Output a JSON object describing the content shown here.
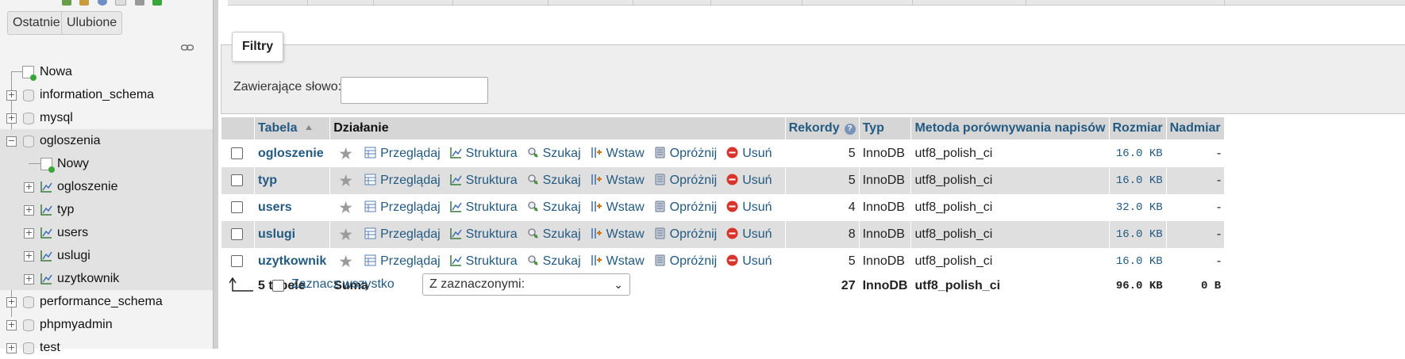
{
  "sidebar": {
    "tabs": [
      "Ostatnie",
      "Ulubione"
    ],
    "tree": [
      {
        "label": "Nowa",
        "level": 0,
        "kind": "new"
      },
      {
        "label": "information_schema",
        "level": 0,
        "kind": "db"
      },
      {
        "label": "mysql",
        "level": 0,
        "kind": "db"
      },
      {
        "label": "ogloszenia",
        "level": 0,
        "kind": "db",
        "expanded": true,
        "selected": true
      },
      {
        "label": "Nowy",
        "level": 1,
        "kind": "new",
        "selected": true
      },
      {
        "label": "ogloszenie",
        "level": 1,
        "kind": "table",
        "selected": true
      },
      {
        "label": "typ",
        "level": 1,
        "kind": "table",
        "selected": true
      },
      {
        "label": "users",
        "level": 1,
        "kind": "table",
        "selected": true
      },
      {
        "label": "uslugi",
        "level": 1,
        "kind": "table",
        "selected": true
      },
      {
        "label": "uzytkownik",
        "level": 1,
        "kind": "table",
        "selected": true
      },
      {
        "label": "performance_schema",
        "level": 0,
        "kind": "db"
      },
      {
        "label": "phpmyadmin",
        "level": 0,
        "kind": "db"
      },
      {
        "label": "test",
        "level": 0,
        "kind": "db"
      }
    ]
  },
  "filters": {
    "legend": "Filtry",
    "label": "Zawierające słowo:",
    "value": ""
  },
  "table": {
    "headers": {
      "table": "Tabela",
      "action": "Działanie",
      "records": "Rekordy",
      "type": "Typ",
      "collation": "Metoda porównywania napisów",
      "size": "Rozmiar",
      "overhead": "Nadmiar"
    },
    "actions": [
      "Przeglądaj",
      "Struktura",
      "Szukaj",
      "Wstaw",
      "Opróżnij",
      "Usuń"
    ],
    "rows": [
      {
        "name": "ogloszenie",
        "records": "5",
        "type": "InnoDB",
        "collation": "utf8_polish_ci",
        "size": "16.0 KB",
        "overhead": "-"
      },
      {
        "name": "typ",
        "records": "5",
        "type": "InnoDB",
        "collation": "utf8_polish_ci",
        "size": "16.0 KB",
        "overhead": "-"
      },
      {
        "name": "users",
        "records": "4",
        "type": "InnoDB",
        "collation": "utf8_polish_ci",
        "size": "32.0 KB",
        "overhead": "-"
      },
      {
        "name": "uslugi",
        "records": "8",
        "type": "InnoDB",
        "collation": "utf8_polish_ci",
        "size": "16.0 KB",
        "overhead": "-"
      },
      {
        "name": "uzytkownik",
        "records": "5",
        "type": "InnoDB",
        "collation": "utf8_polish_ci",
        "size": "16.0 KB",
        "overhead": "-"
      }
    ],
    "footer": {
      "count": "5 tabele",
      "sum": "Suma",
      "records": "27",
      "type": "InnoDB",
      "collation": "utf8_polish_ci",
      "size": "96.0 KB",
      "overhead": "0 B"
    }
  },
  "bottom": {
    "select_all": "Zaznacz wszystko",
    "with_selected": "Z zaznaczonymi:"
  },
  "icons": {
    "browse": "browse-icon",
    "structure": "structure-icon",
    "search": "search-icon",
    "insert": "insert-icon",
    "empty": "empty-icon",
    "drop": "drop-icon",
    "favorite": "star-icon"
  },
  "colors": {
    "link": "#235a81",
    "row_alt": "#dfdfdf",
    "header_bg": "#d6d6d6",
    "drop_red": "#d9342b"
  }
}
